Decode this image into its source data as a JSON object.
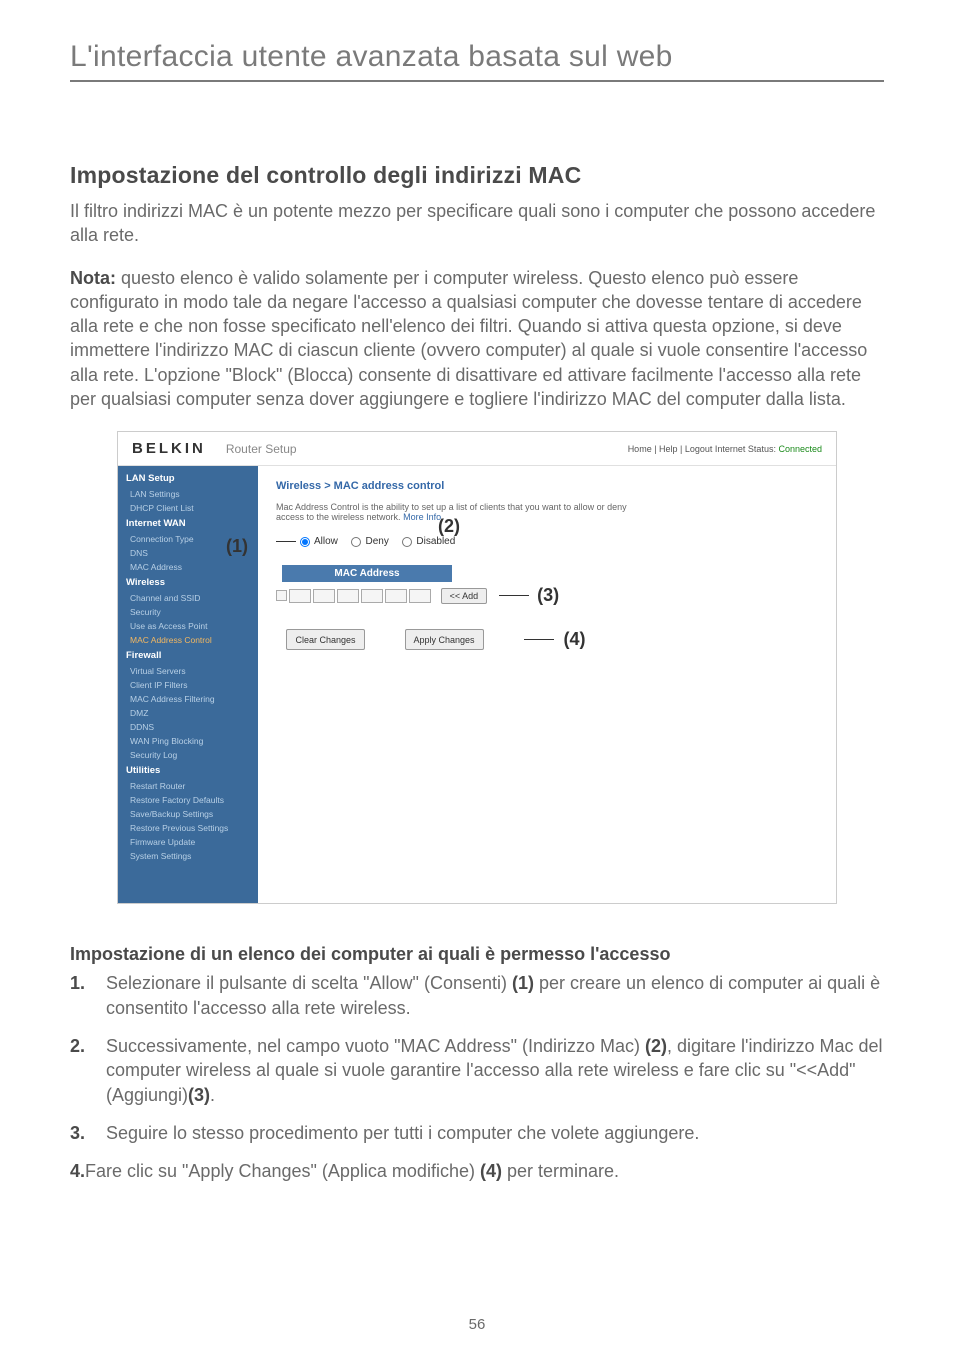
{
  "header": "L'interfaccia utente avanzata basata sul web",
  "section_title": "Impostazione del controllo degli indirizzi MAC",
  "intro": "Il filtro indirizzi MAC è un potente mezzo per specificare quali sono i computer che possono accedere alla rete.",
  "note_label": "Nota:",
  "note_body": " questo elenco è valido solamente per i computer wireless. Questo elenco può essere configurato in modo tale da negare l'accesso a qualsiasi computer che dovesse tentare di accedere alla rete e che non fosse specificato nell'elenco dei filtri. Quando si attiva questa opzione, si deve immettere l'indirizzo MAC di ciascun cliente (ovvero computer) al quale si vuole consentire l'accesso alla rete. L'opzione \"Block\" (Blocca) consente di disattivare ed attivare facilmente l'accesso alla rete per qualsiasi computer senza dover aggiungere e togliere l'indirizzo MAC del computer dalla lista.",
  "screenshot": {
    "logo": "BELKIN",
    "router_setup": "Router Setup",
    "top_right": "Home | Help | Logout   Internet Status: ",
    "connected": "Connected",
    "sidebar": {
      "groups": [
        {
          "heading": "LAN Setup",
          "items": [
            "LAN Settings",
            "DHCP Client List"
          ]
        },
        {
          "heading": "Internet WAN",
          "items": [
            "Connection Type",
            "DNS",
            "MAC Address"
          ]
        },
        {
          "heading": "Wireless",
          "items": [
            "Channel and SSID",
            "Security",
            "Use as Access Point"
          ],
          "orange": "MAC Address Control"
        },
        {
          "heading": "Firewall",
          "items": [
            "Virtual Servers",
            "Client IP Filters",
            "MAC Address Filtering",
            "DMZ",
            "DDNS",
            "WAN Ping Blocking",
            "Security Log"
          ]
        },
        {
          "heading": "Utilities",
          "items": [
            "Restart Router",
            "Restore Factory Defaults",
            "Save/Backup Settings",
            "Restore Previous Settings",
            "Firmware Update",
            "System Settings"
          ]
        }
      ]
    },
    "breadcrumb": "Wireless > MAC address control",
    "desc": "Mac Address Control is the ability to set up a list of clients that you want to allow or deny access to the wireless network.",
    "more_info": "More Info",
    "radio_allow": "Allow",
    "radio_deny": "Deny",
    "radio_disabled": "Disabled",
    "mac_header": "MAC Address",
    "add_btn": "<< Add",
    "clear_btn": "Clear Changes",
    "apply_btn": "Apply Changes",
    "annotations": {
      "a1": "(1)",
      "a2": "(2)",
      "a3": "(3)",
      "a4": "(4)"
    }
  },
  "sub_title": "Impostazione di un elenco dei computer ai quali è permesso l'accesso",
  "steps": [
    {
      "num": "1.",
      "text": "Selezionare il pulsante di scelta \"Allow\" (Consenti) ",
      "bold": "(1)",
      "tail": " per creare un elenco di computer ai quali è consentito l'accesso alla rete wireless."
    },
    {
      "num": "2.",
      "text": "Successivamente, nel campo vuoto \"MAC Address\" (Indirizzo Mac) ",
      "bold": "(2)",
      "tail": ", digitare l'indirizzo Mac del computer wireless al quale si vuole garantire l'accesso alla rete wireless e fare clic su \"<<Add\" (Aggiungi)",
      "bold2": "(3)",
      "tail2": "."
    },
    {
      "num": "3.",
      "text": "Seguire lo stesso procedimento per tutti i computer che volete aggiungere."
    }
  ],
  "final_num": "4.",
  "final_text": "Fare clic su \"Apply Changes\" (Applica modifiche) ",
  "final_bold": "(4)",
  "final_tail": " per terminare.",
  "page_num": "56"
}
